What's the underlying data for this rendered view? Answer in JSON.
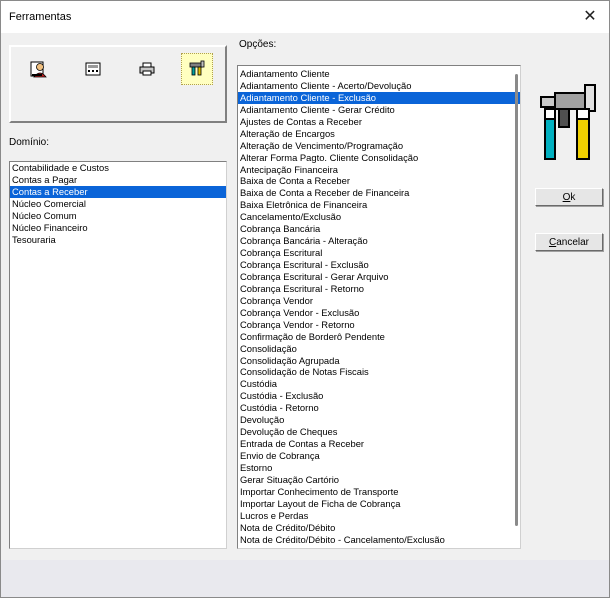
{
  "window": {
    "title": "Ferramentas",
    "close_glyph": "✕"
  },
  "toolbar": {
    "icons": [
      "user-report-icon",
      "calculator-icon",
      "printer-icon",
      "tools-icon"
    ],
    "selected_index": 3
  },
  "dominio": {
    "label": "Domínio:",
    "items": [
      "Contabilidade e Custos",
      "Contas a Pagar",
      "Contas a Receber",
      "Núcleo Comercial",
      "Núcleo Comum",
      "Núcleo Financeiro",
      "Tesouraria"
    ],
    "selected_index": 2
  },
  "opcoes": {
    "label": "Opções:",
    "items": [
      "Adiantamento Cliente",
      "Adiantamento Cliente - Acerto/Devolução",
      "Adiantamento Cliente - Exclusão",
      "Adiantamento Cliente - Gerar Crédito",
      "Ajustes de Contas a Receber",
      "Alteração de Encargos",
      "Alteração de Vencimento/Programação",
      "Alterar Forma Pagto. Cliente Consolidação",
      "Antecipação Financeira",
      "Baixa de Conta a Receber",
      "Baixa de Conta a Receber de Financeira",
      "Baixa Eletrônica de Financeira",
      "Cancelamento/Exclusão",
      "Cobrança Bancária",
      "Cobrança Bancária - Alteração",
      "Cobrança Escritural",
      "Cobrança Escritural - Exclusão",
      "Cobrança Escritural - Gerar Arquivo",
      "Cobrança Escritural - Retorno",
      "Cobrança Vendor",
      "Cobrança Vendor - Exclusão",
      "Cobrança Vendor - Retorno",
      "Confirmação de Borderô Pendente",
      "Consolidação",
      "Consolidação Agrupada",
      "Consolidação de Notas Fiscais",
      "Custódia",
      "Custódia - Exclusão",
      "Custódia - Retorno",
      "Devolução",
      "Devolução de Cheques",
      "Entrada de Contas a Receber",
      "Envio de Cobrança",
      "Estorno",
      "Gerar Situação Cartório",
      "Importar Conhecimento de Transporte",
      "Importar Layout de Ficha de Cobrança",
      "Lucros e Perdas",
      "Nota de Crédito/Débito",
      "Nota de Crédito/Débito - Cancelamento/Exclusão"
    ],
    "selected_index": 2
  },
  "buttons": {
    "ok": {
      "mnemonic": "O",
      "rest": "k"
    },
    "cancel": {
      "mnemonic": "C",
      "rest": "ancelar"
    }
  },
  "colors": {
    "selection": "#0a64d8",
    "tool_selected_bg": "#ffffc0"
  }
}
